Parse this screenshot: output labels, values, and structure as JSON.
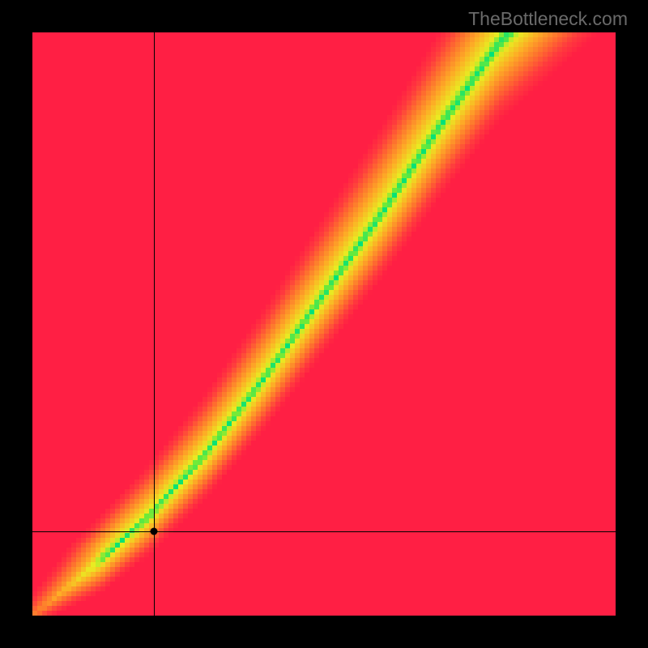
{
  "watermark": "TheBottleneck.com",
  "chart_data": {
    "type": "heatmap",
    "title": "",
    "xlabel": "",
    "ylabel": "",
    "xlim": [
      0,
      100
    ],
    "ylim": [
      0,
      100
    ],
    "grid": false,
    "legend": false,
    "marker": {
      "x": 20.8,
      "y": 14.5
    },
    "crosshair": {
      "x": 20.8,
      "y": 14.5
    },
    "optimal_path": {
      "description": "approximate center line of the green band",
      "points": [
        {
          "x": 0,
          "y": 0
        },
        {
          "x": 10,
          "y": 8
        },
        {
          "x": 20,
          "y": 17
        },
        {
          "x": 30,
          "y": 28
        },
        {
          "x": 40,
          "y": 41
        },
        {
          "x": 50,
          "y": 55
        },
        {
          "x": 60,
          "y": 69
        },
        {
          "x": 70,
          "y": 84
        },
        {
          "x": 80,
          "y": 98
        },
        {
          "x": 82,
          "y": 100
        }
      ]
    },
    "color_stops": [
      {
        "t": 0.0,
        "color": "#00e27a"
      },
      {
        "t": 0.05,
        "color": "#6dea3a"
      },
      {
        "t": 0.12,
        "color": "#e9ec22"
      },
      {
        "t": 0.35,
        "color": "#fdae26"
      },
      {
        "t": 0.6,
        "color": "#fe6f2f"
      },
      {
        "t": 0.8,
        "color": "#ff3b3e"
      },
      {
        "t": 1.0,
        "color": "#ff1f44"
      }
    ],
    "annotations": []
  },
  "colors": {
    "background": "#000000",
    "watermark": "#6a6a6a"
  }
}
